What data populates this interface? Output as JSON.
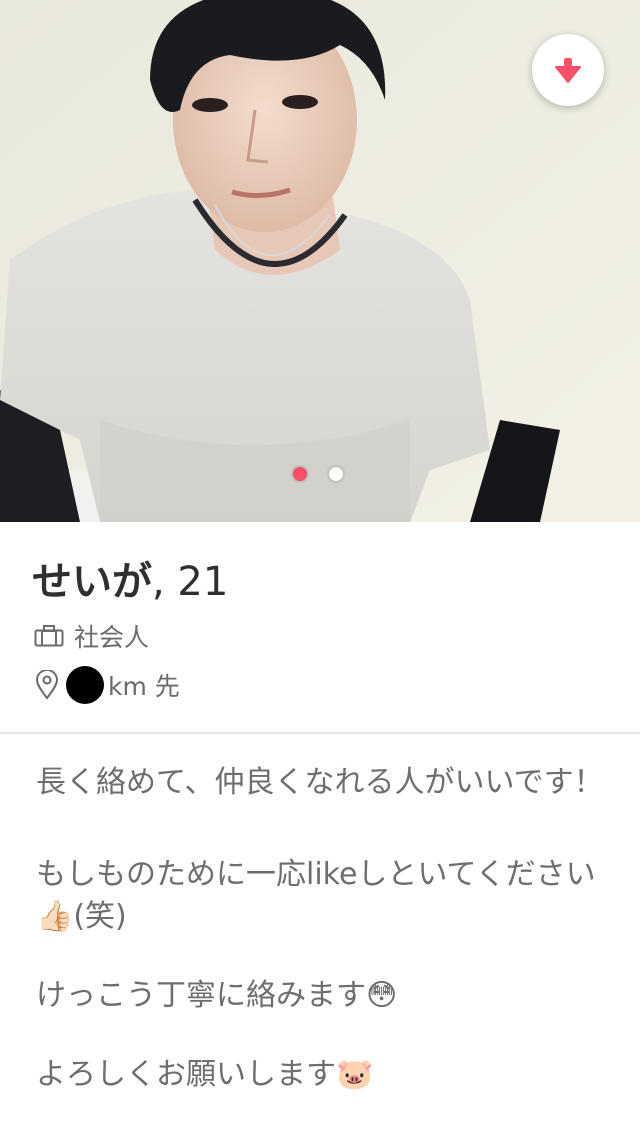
{
  "photo": {
    "carousel": {
      "count": 2,
      "active_index": 0
    },
    "collapse_icon": "arrow-down-icon",
    "accent": "#fd5068"
  },
  "profile": {
    "name": "せいが",
    "age_text": ", 21",
    "job": "社会人",
    "job_icon": "briefcase-icon",
    "distance_text": "km 先",
    "distance_icon": "location-pin-icon"
  },
  "bio": {
    "para1": "長く絡めて、仲良くなれる人がいいです！",
    "para2": "もしものために一応likeしといてください👍🏻(笑)",
    "para3": "けっこう丁寧に絡みます😳",
    "para4": "よろしくお願いします🐷"
  }
}
